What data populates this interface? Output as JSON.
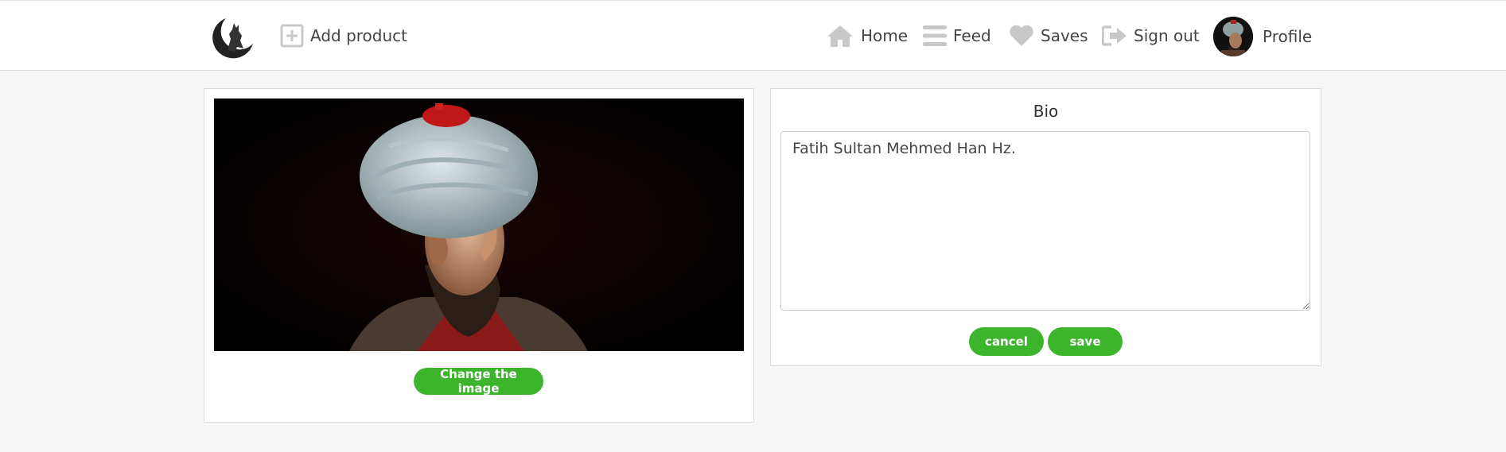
{
  "nav": {
    "add_product": "Add product",
    "home": "Home",
    "feed": "Feed",
    "saves": "Saves",
    "sign_out": "Sign out",
    "profile": "Profile"
  },
  "image_panel": {
    "change_button": "Change the image"
  },
  "bio": {
    "title": "Bio",
    "text": "Fatih Sultan Mehmed Han Hz.",
    "cancel": "cancel",
    "save": "save"
  },
  "colors": {
    "accent": "#3cb42c",
    "icon_gray": "#c8c8c8",
    "background": "#f6f6f6"
  },
  "icons": {
    "logo": "wolf-moon-logo-icon",
    "add": "plus-square-icon",
    "home": "home-icon",
    "feed": "bars-icon",
    "saves": "heart-icon",
    "sign_out": "sign-out-icon"
  }
}
